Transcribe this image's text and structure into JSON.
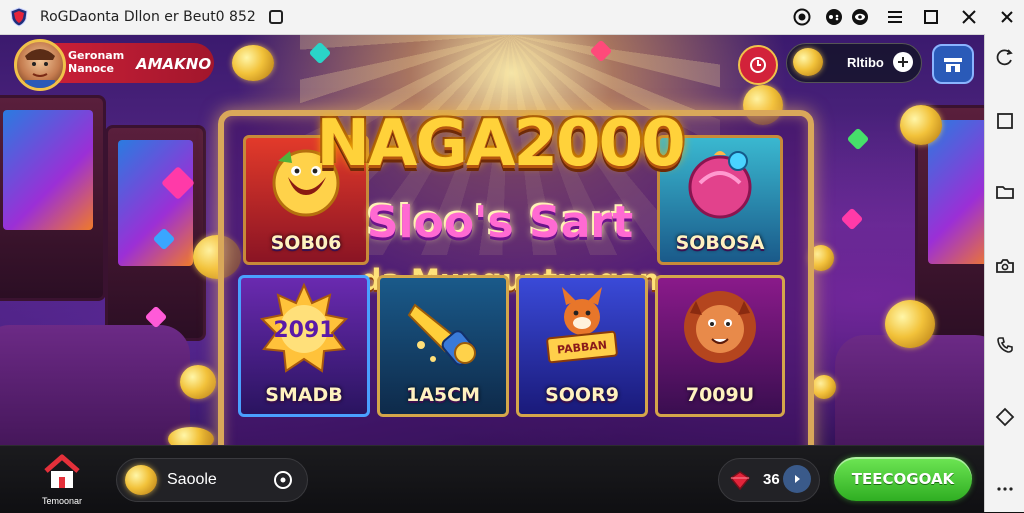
{
  "window": {
    "title": "RoGDaonta Dllon er Beut0 852",
    "icon": "shield-app-icon"
  },
  "game": {
    "logo_title": "NAGA2000",
    "subtitle_line1": "Sloo's Sart",
    "subtitle_line2": "da Munguntungan",
    "profile": {
      "name_line1": "Geronam",
      "name_line2": "Nanoce",
      "balance_text": "AMAKNO"
    },
    "wallet_text": "Rltibo",
    "top_cards": [
      {
        "label": "SOB06",
        "icon": "dragon-icon",
        "color": "#c8242c"
      },
      {
        "label": "SOBOSA",
        "icon": "fruit-orb-icon",
        "color": "#3aa0b8"
      }
    ],
    "bottom_cards": [
      {
        "label": "SMADB",
        "icon": "sun-badge-icon",
        "badge_text": "2091"
      },
      {
        "label": "1A5CM",
        "icon": "golden-cannon-icon"
      },
      {
        "label": "SOOR9",
        "icon": "fox-scroll-icon",
        "badge_text": "PABBAN"
      },
      {
        "label": "7009U",
        "icon": "lion-icon"
      }
    ]
  },
  "bottombar": {
    "home_label": "Temoonar",
    "search_label": "Saoole",
    "credit_value": "36",
    "play_label": "TEECOGOAK"
  },
  "colors": {
    "accent_green": "#2fae22",
    "accent_red": "#d2223a",
    "gold": "#f2c23a"
  }
}
